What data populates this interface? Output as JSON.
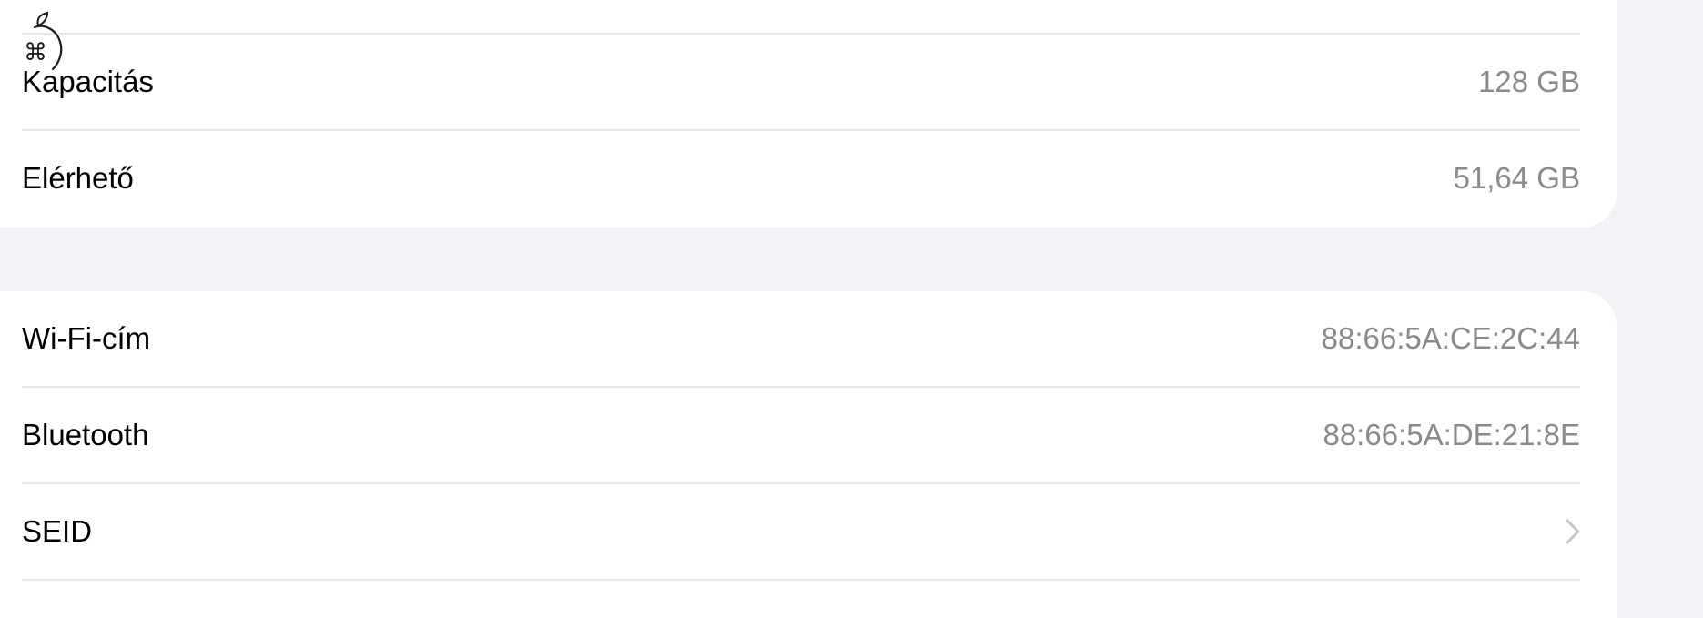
{
  "storage_section": {
    "rows": [
      {
        "label": "Kapacitás",
        "value": "128 GB"
      },
      {
        "label": "Elérhető",
        "value": "51,64 GB"
      }
    ]
  },
  "network_section": {
    "rows": [
      {
        "label": "Wi-Fi-cím",
        "value": "88:66:5A:CE:2C:44"
      },
      {
        "label": "Bluetooth",
        "value": "88:66:5A:DE:21:8E"
      },
      {
        "label": "SEID",
        "value": "",
        "icon": "chevron-right-icon"
      }
    ]
  },
  "overlay": {
    "icon": "apple-logo-icon",
    "glyph": "⌘"
  },
  "colors": {
    "background": "#f2f2f7",
    "card": "#ffffff",
    "separator": "#e5e5ea",
    "label": "#000000",
    "value": "#8a8a8e",
    "chevron": "#c4c4c7"
  }
}
